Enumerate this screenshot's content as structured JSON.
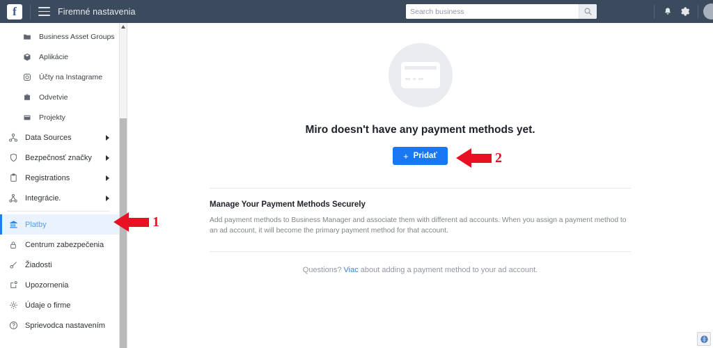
{
  "topbar": {
    "logo": "f",
    "logo_icon": "facebook-logo",
    "menu_icon": "hamburger-menu-icon",
    "title": "Firemné nastavenia",
    "search": {
      "placeholder": "Search business",
      "value": "",
      "icon": "search-icon"
    },
    "notifications_icon": "bell-icon",
    "settings_icon": "gear-icon",
    "avatar": "user-avatar"
  },
  "sidebar": {
    "items": [
      {
        "label": "Business Asset Groups",
        "icon": "folder-icon",
        "sub": true,
        "caret": false,
        "active": false
      },
      {
        "label": "Aplikácie",
        "icon": "package-icon",
        "sub": true,
        "caret": false,
        "active": false
      },
      {
        "label": "Účty na Instagrame",
        "icon": "instagram-icon",
        "sub": true,
        "caret": false,
        "active": false
      },
      {
        "label": "Odvetvie",
        "icon": "briefcase-icon",
        "sub": true,
        "caret": false,
        "active": false
      },
      {
        "label": "Projekty",
        "icon": "projects-icon",
        "sub": true,
        "caret": false,
        "active": false
      },
      {
        "label": "Data Sources",
        "icon": "data-sources-icon",
        "sub": false,
        "caret": true,
        "active": false
      },
      {
        "label": "Bezpečnosť značky",
        "icon": "shield-icon",
        "sub": false,
        "caret": true,
        "active": false
      },
      {
        "label": "Registrations",
        "icon": "clipboard-icon",
        "sub": false,
        "caret": true,
        "active": false
      },
      {
        "label": "Integrácie.",
        "icon": "integrations-icon",
        "sub": false,
        "caret": true,
        "active": false
      },
      {
        "label": "Platby",
        "icon": "bank-icon",
        "sub": false,
        "caret": false,
        "active": true,
        "separator_before": true
      },
      {
        "label": "Centrum zabezpečenia",
        "icon": "lock-icon",
        "sub": false,
        "caret": false,
        "active": false
      },
      {
        "label": "Žiadosti",
        "icon": "request-icon",
        "sub": false,
        "caret": false,
        "active": false
      },
      {
        "label": "Upozornenia",
        "icon": "alerts-icon",
        "sub": false,
        "caret": false,
        "active": false
      },
      {
        "label": "Údaje o firme",
        "icon": "business-info-icon",
        "sub": false,
        "caret": false,
        "active": false
      },
      {
        "label": "Sprievodca nastavením",
        "icon": "help-circle-icon",
        "sub": false,
        "caret": false,
        "active": false
      }
    ],
    "scrollbar": {
      "up_arrow_icon": "scroll-up-arrow-icon"
    }
  },
  "main": {
    "empty_state": {
      "illustration_icon": "credit-card-icon",
      "title": "Miro doesn't have any payment methods yet.",
      "add_button": {
        "label": "Pridať",
        "plus": "+"
      }
    },
    "info": {
      "heading": "Manage Your Payment Methods Securely",
      "body": "Add payment methods to Business Manager and associate them with different ad accounts. When you assign a payment method to an ad account, it will become the primary payment method for that account."
    },
    "questions": {
      "prefix": "Questions?",
      "link": "Viac",
      "suffix": "about adding a payment method to your ad account."
    }
  },
  "annotations": [
    {
      "number": "1",
      "target": "sidebar-item-platby"
    },
    {
      "number": "2",
      "target": "add-payment-method-button"
    }
  ],
  "footer": {
    "globe_icon": "globe-icon"
  },
  "colors": {
    "topbar_bg": "#3b4b5d",
    "accent_blue": "#1877f2",
    "active_item_bg": "#eaf2fd",
    "annotation_red": "#e81123"
  }
}
